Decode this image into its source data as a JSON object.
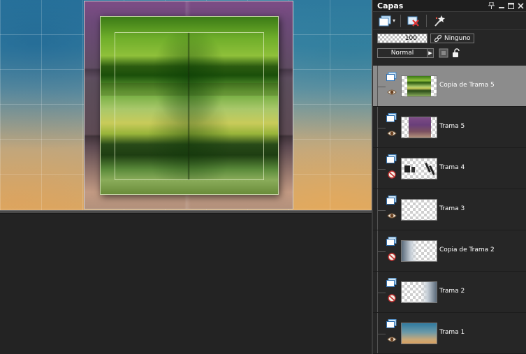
{
  "palette": {
    "title": "Capas",
    "titlebar_buttons": [
      "pin-icon",
      "minimize-icon",
      "maximize-icon",
      "close-icon"
    ]
  },
  "toolbar": {
    "opacity_value": "100",
    "mask_label": "Ninguno",
    "blend_mode": "Normal"
  },
  "layers": [
    {
      "name": "Copia de Trama 5",
      "visible": true,
      "selected": true,
      "thumb": "green-art"
    },
    {
      "name": "Trama 5",
      "visible": true,
      "selected": false,
      "thumb": "purple-art"
    },
    {
      "name": "Trama 4",
      "visible": false,
      "selected": false,
      "thumb": "text-art"
    },
    {
      "name": "Trama 3",
      "visible": true,
      "selected": false,
      "thumb": "empty"
    },
    {
      "name": "Copia de Trama 2",
      "visible": false,
      "selected": false,
      "thumb": "cloud-left"
    },
    {
      "name": "Trama 2",
      "visible": false,
      "selected": false,
      "thumb": "cloud-right"
    },
    {
      "name": "Trama 1",
      "visible": true,
      "selected": false,
      "thumb": "gradient-bg"
    }
  ],
  "colors": {
    "selected_row": "#8c8c8c",
    "panel_bg": "#262626",
    "workspace_bg": "#232323"
  }
}
